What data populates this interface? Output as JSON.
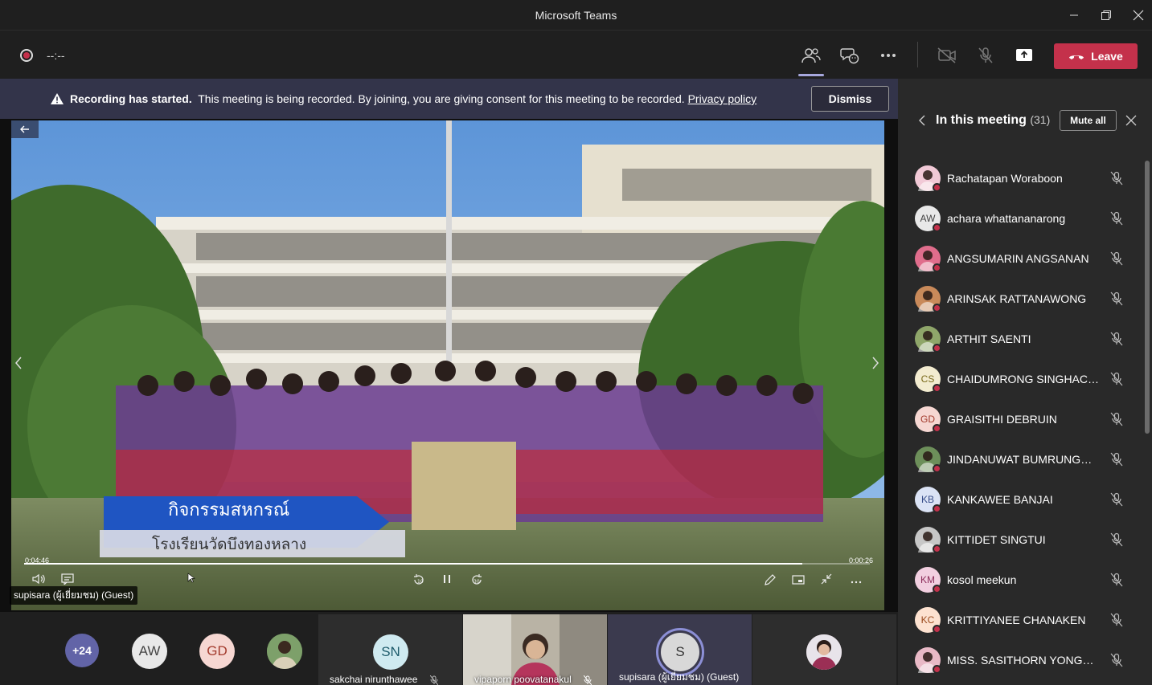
{
  "window": {
    "title": "Microsoft Teams"
  },
  "toolbar": {
    "timer": "--:--",
    "leave_label": "Leave"
  },
  "banner": {
    "bold": "Recording has started.",
    "text": "This meeting is being recorded. By joining, you are giving consent for this meeting to be recorded.",
    "link": "Privacy policy",
    "dismiss_label": "Dismiss"
  },
  "video": {
    "elapsed": "0:04:46",
    "remaining": "0:00:26",
    "presenter": "supisara (ผู้เยี่ยมชม) (Guest)",
    "caption_title": "กิจกรรมสหกรณ์",
    "caption_subtitle": "โรงเรียนวัดบึงทองหลาง",
    "progress": 0.92
  },
  "strip": {
    "overflow": "+24",
    "avatars": [
      {
        "initials": "AW",
        "color": "#e8e8e8",
        "fg": "#444"
      },
      {
        "initials": "GD",
        "color": "#f6d7d2",
        "fg": "#a33b2d"
      }
    ],
    "tiles": [
      {
        "name": "sakchai nirunthawee",
        "initials": "SN",
        "color": "#cfeaf0",
        "fg": "#1e5b6b"
      },
      {
        "name": "vipaporn poovatanakul",
        "initials": "",
        "color": "",
        "fg": ""
      },
      {
        "name": "supisara (ผู้เยี่ยมชม) (Guest)",
        "initials": "S",
        "color": "#d8d8d8",
        "fg": "#333"
      }
    ]
  },
  "panel": {
    "title": "In this meeting",
    "count": "(31)",
    "mute_all_label": "Mute all",
    "participants": [
      {
        "name": "Rachatapan Woraboon",
        "initials": "",
        "color": "#f1c9d6",
        "fg": "#7a2b46"
      },
      {
        "name": "achara whattananarong",
        "initials": "AW",
        "color": "#e8e8e8",
        "fg": "#444"
      },
      {
        "name": "ANGSUMARIN ANGSANAN",
        "initials": "",
        "color": "#e06d8c",
        "fg": "#fff"
      },
      {
        "name": "ARINSAK RATTANAWONG",
        "initials": "",
        "color": "#c98a5a",
        "fg": "#fff"
      },
      {
        "name": "ARTHIT SAENTI",
        "initials": "",
        "color": "#8fa66a",
        "fg": "#fff"
      },
      {
        "name": "CHAIDUMRONG SINGHACHA...",
        "initials": "CS",
        "color": "#f3ecd0",
        "fg": "#7a6a1c"
      },
      {
        "name": "GRAISITHI DEBRUIN",
        "initials": "GD",
        "color": "#f6d7d2",
        "fg": "#a33b2d"
      },
      {
        "name": "JINDANUWAT BUMRUNGCH...",
        "initials": "",
        "color": "#6d8f5a",
        "fg": "#fff"
      },
      {
        "name": "KANKAWEE BANJAI",
        "initials": "KB",
        "color": "#dbe3f5",
        "fg": "#3a4f8a"
      },
      {
        "name": "KITTIDET SINGTUI",
        "initials": "",
        "color": "#c7c7c7",
        "fg": "#333"
      },
      {
        "name": "kosol meekun",
        "initials": "KM",
        "color": "#f2cfe0",
        "fg": "#8c2d5a"
      },
      {
        "name": "KRITTIYANEE CHANAKEN",
        "initials": "KC",
        "color": "#fde2d0",
        "fg": "#9a4a1c"
      },
      {
        "name": "MISS. SASITHORN YONGYUT",
        "initials": "",
        "color": "#e9b9c6",
        "fg": "#fff"
      }
    ]
  }
}
